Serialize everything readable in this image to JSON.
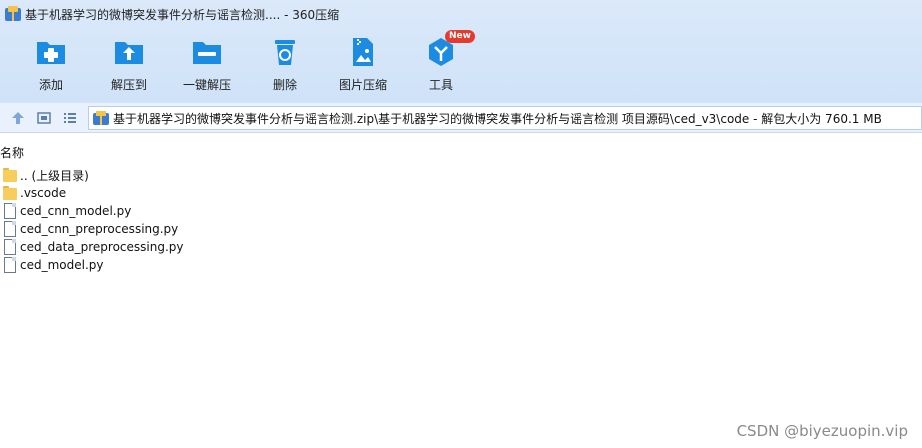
{
  "window": {
    "title": "基于机器学习的微博突发事件分析与谣言检测.... - 360压缩"
  },
  "toolbar": {
    "items": [
      {
        "label": "添加",
        "icon": "add-icon"
      },
      {
        "label": "解压到",
        "icon": "extract-to-icon"
      },
      {
        "label": "一键解压",
        "icon": "one-click-extract-icon"
      },
      {
        "label": "删除",
        "icon": "delete-icon"
      },
      {
        "label": "图片压缩",
        "icon": "image-compress-icon"
      },
      {
        "label": "工具",
        "icon": "tools-icon",
        "badge": "New"
      }
    ]
  },
  "address": {
    "path": "基于机器学习的微博突发事件分析与谣言检测.zip\\基于机器学习的微博突发事件分析与谣言检测 项目源码\\ced_v3\\code - 解包大小为 760.1 MB"
  },
  "list": {
    "column_name": "名称",
    "items": [
      {
        "name": ".. (上级目录)",
        "type": "folder"
      },
      {
        "name": ".vscode",
        "type": "folder"
      },
      {
        "name": "ced_cnn_model.py",
        "type": "file"
      },
      {
        "name": "ced_cnn_preprocessing.py",
        "type": "file"
      },
      {
        "name": "ced_data_preprocessing.py",
        "type": "file"
      },
      {
        "name": "ced_model.py",
        "type": "file"
      }
    ]
  },
  "watermark": "CSDN @biyezuopin.vip",
  "colors": {
    "accent": "#1c8ce3",
    "badge": "#e63a2e",
    "folder": "#f7cd5c"
  }
}
